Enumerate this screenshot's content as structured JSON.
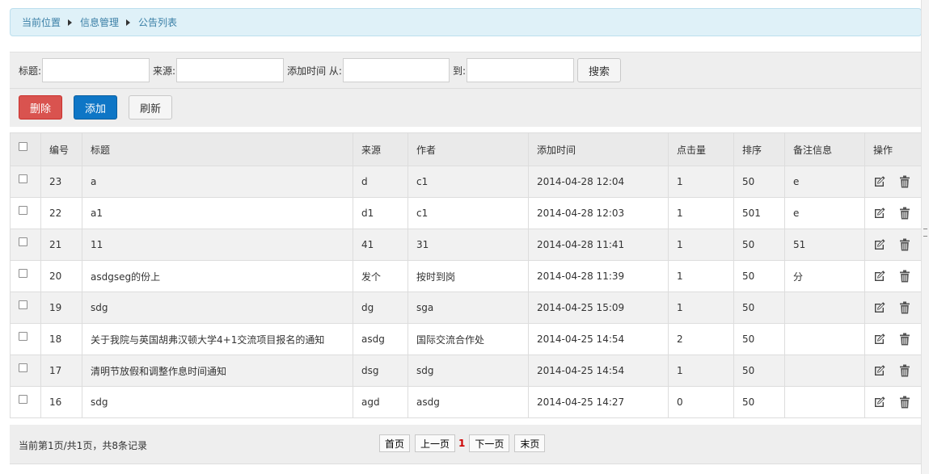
{
  "breadcrumb": {
    "items": [
      "当前位置",
      "信息管理",
      "公告列表"
    ]
  },
  "search": {
    "title_label": "标题:",
    "source_label": "来源:",
    "date_from_label": "添加时间 从:",
    "date_to_label": "到:",
    "title_value": "",
    "source_value": "",
    "date_from_value": "",
    "date_to_value": "",
    "search_button": "搜索"
  },
  "actions": {
    "delete": "删除",
    "add": "添加",
    "refresh": "刷新"
  },
  "table": {
    "headers": [
      "编号",
      "标题",
      "来源",
      "作者",
      "添加时间",
      "点击量",
      "排序",
      "备注信息",
      "操作"
    ],
    "rows": [
      [
        "23",
        "a",
        "d",
        "c1",
        "2014-04-28 12:04",
        "1",
        "50",
        "e"
      ],
      [
        "22",
        "a1",
        "d1",
        "c1",
        "2014-04-28 12:03",
        "1",
        "501",
        "e"
      ],
      [
        "21",
        "11",
        "41",
        "31",
        "2014-04-28 11:41",
        "1",
        "50",
        "51"
      ],
      [
        "20",
        "asdgseg的份上",
        "发个",
        "按时到岗",
        "2014-04-28 11:39",
        "1",
        "50",
        "分"
      ],
      [
        "19",
        "sdg",
        "dg",
        "sga",
        "2014-04-25 15:09",
        "1",
        "50",
        ""
      ],
      [
        "18",
        "关于我院与英国胡弗汉顿大学4+1交流项目报名的通知",
        "asdg",
        "国际交流合作处",
        "2014-04-25 14:54",
        "2",
        "50",
        ""
      ],
      [
        "17",
        "清明节放假和调整作息时间通知",
        "dsg",
        "sdg",
        "2014-04-25 14:54",
        "1",
        "50",
        ""
      ],
      [
        "16",
        "sdg",
        "agd",
        "asdg",
        "2014-04-25 14:27",
        "0",
        "50",
        ""
      ]
    ]
  },
  "pagination": {
    "summary": "当前第1页/共1页，共8条记录",
    "first": "首页",
    "prev": "上一页",
    "current": "1",
    "next": "下一页",
    "last": "末页"
  },
  "icons": {
    "edit": "edit-icon",
    "delete": "trash-icon"
  },
  "colors": {
    "delete_button": "#d9534f",
    "add_button": "#0e76c6",
    "breadcrumb_bg": "#dff1f8",
    "current_page": "#cc0000"
  }
}
